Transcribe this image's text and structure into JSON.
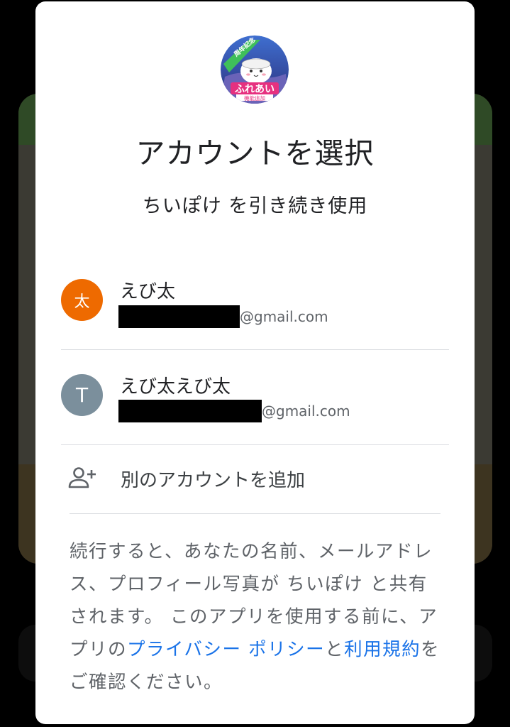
{
  "dialog": {
    "app_logo": {
      "badge": "周年記念",
      "line1": "ふれあい",
      "line2": "機能追加"
    },
    "title": "アカウントを選択",
    "subtitle": "ちいぽけ を引き続き使用",
    "accounts": [
      {
        "initial": "太",
        "name": "えび太",
        "email_suffix": "@gmail.com",
        "avatar_color": "#ee6a00"
      },
      {
        "initial": "T",
        "name": "えび太えび太",
        "email_suffix": "@gmail.com",
        "avatar_color": "#7b8f9c"
      }
    ],
    "add_account_label": "別のアカウントを追加",
    "disclaimer": {
      "part1": "続行すると、あなたの名前、メールアドレス、プロフィール写真が ちいぽけ と共有されます。 このアプリを使用する前に、アプリの",
      "privacy_link": "プライバシー ポリシー",
      "part2": "と",
      "terms_link": "利用規約",
      "part3": "をご確認ください。"
    }
  },
  "colors": {
    "link": "#1a73e8",
    "text_primary": "#202124",
    "text_secondary": "#5f6368"
  }
}
